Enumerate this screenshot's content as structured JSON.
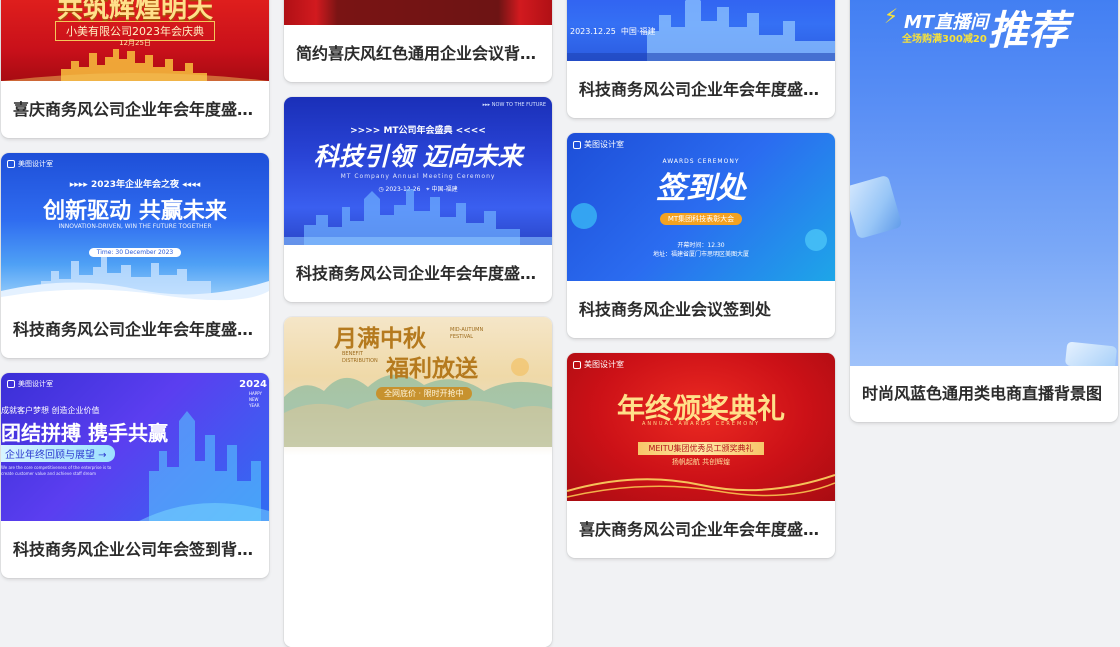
{
  "cards": [
    {
      "caption": "喜庆商务风公司企业年会年度盛典背景板",
      "poster": {
        "headline": "共筑辉煌明天",
        "sub": "小美有限公司2023年会庆典",
        "date": "12月25日"
      }
    },
    {
      "caption": "科技商务风公司企业年会年度盛典展板",
      "poster": {
        "brand": "美图设计室",
        "kicker": "2023年企业年会之夜",
        "headline": "创新驱动  共赢未来",
        "english": "INNOVATION-DRIVEN, WIN THE FUTURE TOGETHER",
        "pill": "Time: 30 December 2023"
      }
    },
    {
      "caption": "科技商务风企业公司年会签到背景墙",
      "poster": {
        "brand": "美图设计室",
        "year": "2024",
        "year_sub": "HAPPY NEW YEAR",
        "slogan": "成就客户梦想  创造企业价值",
        "headline": "团结拼搏 携手共赢",
        "pill": "企业年终回顾与展望  →",
        "small": "We are the core competitiveness of the enterprise is to create customer value and achieve staff dream"
      }
    },
    {
      "caption": "简约喜庆风红色通用企业会议背景板"
    },
    {
      "caption": "科技商务风公司企业年会年度盛典展板",
      "poster": {
        "corner": "NOW TO THE FUTURE",
        "kicker": "MT公司年会盛典",
        "headline": "科技引领 迈向未来",
        "english": "MT Company Annual Meeting Ceremony",
        "date": "2023-12-26",
        "place": "中国-福建"
      }
    },
    {
      "poster": {
        "headline1": "月满中秋",
        "headline2": "福利放送",
        "en1": "MID-AUTUMN FESTIVAL",
        "en2": "BENEFIT DISTRIBUTION",
        "pill": "全网底价 · 限时开抢中"
      }
    },
    {
      "caption": "科技商务风公司企业年会年度盛典展板",
      "poster": {
        "date": "2023.12.25",
        "place": "中国·福建"
      }
    },
    {
      "caption": "科技商务风企业会议签到处",
      "poster": {
        "brand": "美图设计室",
        "english": "AWARDS CEREMONY",
        "headline": "签到处",
        "pill": "MT集团科技表彰大会",
        "time": "开幕时间：12.30",
        "address": "地址：福建省厦门市思明区美图大厦"
      }
    },
    {
      "caption": "喜庆商务风公司企业年会年度盛典展板",
      "poster": {
        "brand": "美图设计室",
        "headline": "年终颁奖典礼",
        "english": "ANNUAL AWARDS CEREMONY",
        "pill": "MEITU集团优秀员工颁奖典礼",
        "tagline": "扬帆起航   共创辉煌"
      }
    },
    {
      "caption": "时尚风蓝色通用类电商直播背景图",
      "poster": {
        "title": "MT直播间",
        "sub": "全场购满300减20",
        "big": "推荐"
      }
    }
  ]
}
